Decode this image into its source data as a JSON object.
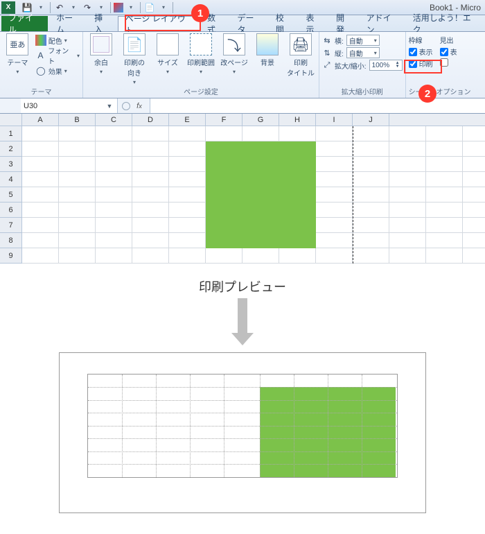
{
  "title": "Book1 - Micro",
  "qat_icons": [
    "save",
    "undo",
    "redo",
    "sep",
    "color",
    "sep",
    "new"
  ],
  "file_tab": "ファイル",
  "tabs": [
    "ホーム",
    "挿入",
    "ページ レイアウト",
    "数式",
    "データ",
    "校閲",
    "表示",
    "開発",
    "アドイン",
    "活用しよう！エク"
  ],
  "active_tab_index": 2,
  "ribbon": {
    "themes": {
      "theme_btn": "テーマ",
      "colors": "配色",
      "fonts": "フォント",
      "effects": "効果",
      "label": "テーマ"
    },
    "page_setup": {
      "margins": "余白",
      "orientation": "印刷の\n向き",
      "size": "サイズ",
      "print_area": "印刷範囲",
      "breaks": "改ページ",
      "background": "背景",
      "print_titles": "印刷\nタイトル",
      "label": "ページ設定"
    },
    "scale": {
      "width_lbl": "横:",
      "height_lbl": "縦:",
      "scale_lbl": "拡大/縮小:",
      "width_val": "自動",
      "height_val": "自動",
      "scale_val": "100%",
      "label": "拡大縮小印刷"
    },
    "sheet_opts": {
      "gridlines": "枠線",
      "headings": "見出",
      "view": "表示",
      "print": "印刷",
      "view2": "表",
      "label": "シートのオプション"
    }
  },
  "namebox": "U30",
  "columns": [
    "A",
    "B",
    "C",
    "D",
    "E",
    "F",
    "G",
    "H",
    "I",
    "J"
  ],
  "rows": [
    "1",
    "2",
    "3",
    "4",
    "5",
    "6",
    "7",
    "8",
    "9"
  ],
  "callouts": {
    "1": "1",
    "2": "2"
  },
  "preview_title": "印刷プレビュー"
}
